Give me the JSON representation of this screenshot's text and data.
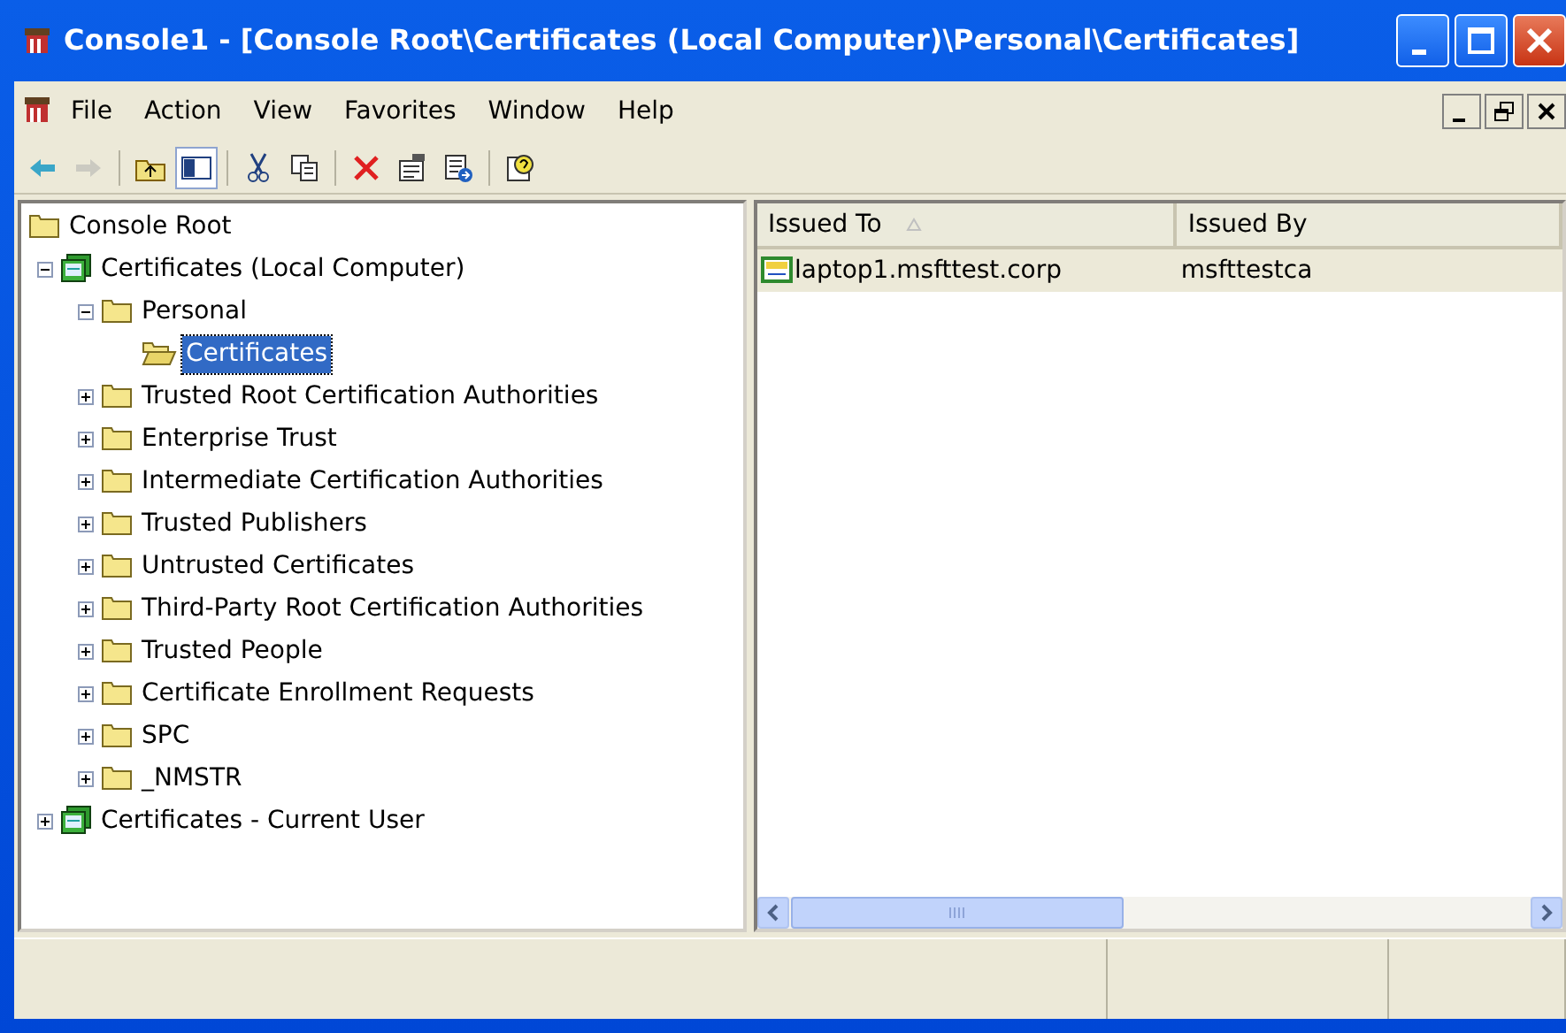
{
  "window": {
    "title": "Console1 - [Console Root\\Certificates (Local Computer)\\Personal\\Certificates]"
  },
  "menu": [
    {
      "label": "File"
    },
    {
      "label": "Action"
    },
    {
      "label": "View"
    },
    {
      "label": "Favorites"
    },
    {
      "label": "Window"
    },
    {
      "label": "Help"
    }
  ],
  "toolbar": [
    {
      "kind": "back",
      "disabled": false,
      "pressed": false
    },
    {
      "kind": "forward",
      "disabled": true,
      "pressed": false
    },
    {
      "kind": "sep"
    },
    {
      "kind": "up",
      "disabled": false,
      "pressed": false
    },
    {
      "kind": "tree",
      "disabled": false,
      "pressed": true
    },
    {
      "kind": "sep"
    },
    {
      "kind": "cut",
      "disabled": false,
      "pressed": false
    },
    {
      "kind": "copy",
      "disabled": false,
      "pressed": false
    },
    {
      "kind": "sep"
    },
    {
      "kind": "delete",
      "disabled": false,
      "pressed": false
    },
    {
      "kind": "properties",
      "disabled": false,
      "pressed": false
    },
    {
      "kind": "export",
      "disabled": false,
      "pressed": false
    },
    {
      "kind": "sep"
    },
    {
      "kind": "help",
      "disabled": false,
      "pressed": false
    }
  ],
  "tree": [
    {
      "label": "Console Root",
      "kind": "folder",
      "selected": false,
      "children": [
        {
          "label": "Certificates (Local Computer)",
          "kind": "store",
          "expanded": true,
          "selected": false,
          "children": [
            {
              "label": "Personal",
              "kind": "folder",
              "expanded": true,
              "selected": false,
              "children": [
                {
                  "label": "Certificates",
                  "kind": "openfolder",
                  "selected": true
                }
              ]
            },
            {
              "label": "Trusted Root Certification Authorities",
              "kind": "folder",
              "expanded": false,
              "selected": false
            },
            {
              "label": "Enterprise Trust",
              "kind": "folder",
              "expanded": false,
              "selected": false
            },
            {
              "label": "Intermediate Certification Authorities",
              "kind": "folder",
              "expanded": false,
              "selected": false
            },
            {
              "label": "Trusted Publishers",
              "kind": "folder",
              "expanded": false,
              "selected": false
            },
            {
              "label": "Untrusted Certificates",
              "kind": "folder",
              "expanded": false,
              "selected": false
            },
            {
              "label": "Third-Party Root Certification Authorities",
              "kind": "folder",
              "expanded": false,
              "selected": false
            },
            {
              "label": "Trusted People",
              "kind": "folder",
              "expanded": false,
              "selected": false
            },
            {
              "label": "Certificate Enrollment Requests",
              "kind": "folder",
              "expanded": false,
              "selected": false
            },
            {
              "label": "SPC",
              "kind": "folder",
              "expanded": false,
              "selected": false
            },
            {
              "label": "_NMSTR",
              "kind": "folder",
              "expanded": false,
              "selected": false
            }
          ]
        },
        {
          "label": "Certificates - Current User",
          "kind": "store",
          "expanded": false,
          "selected": false
        }
      ]
    }
  ],
  "list": {
    "columns": [
      {
        "label": "Issued To",
        "sorted": true
      },
      {
        "label": "Issued By",
        "sorted": false
      }
    ],
    "rows": [
      {
        "cells": [
          "laptop1.msfttest.corp",
          "msfttestca"
        ],
        "selected": true
      }
    ]
  }
}
